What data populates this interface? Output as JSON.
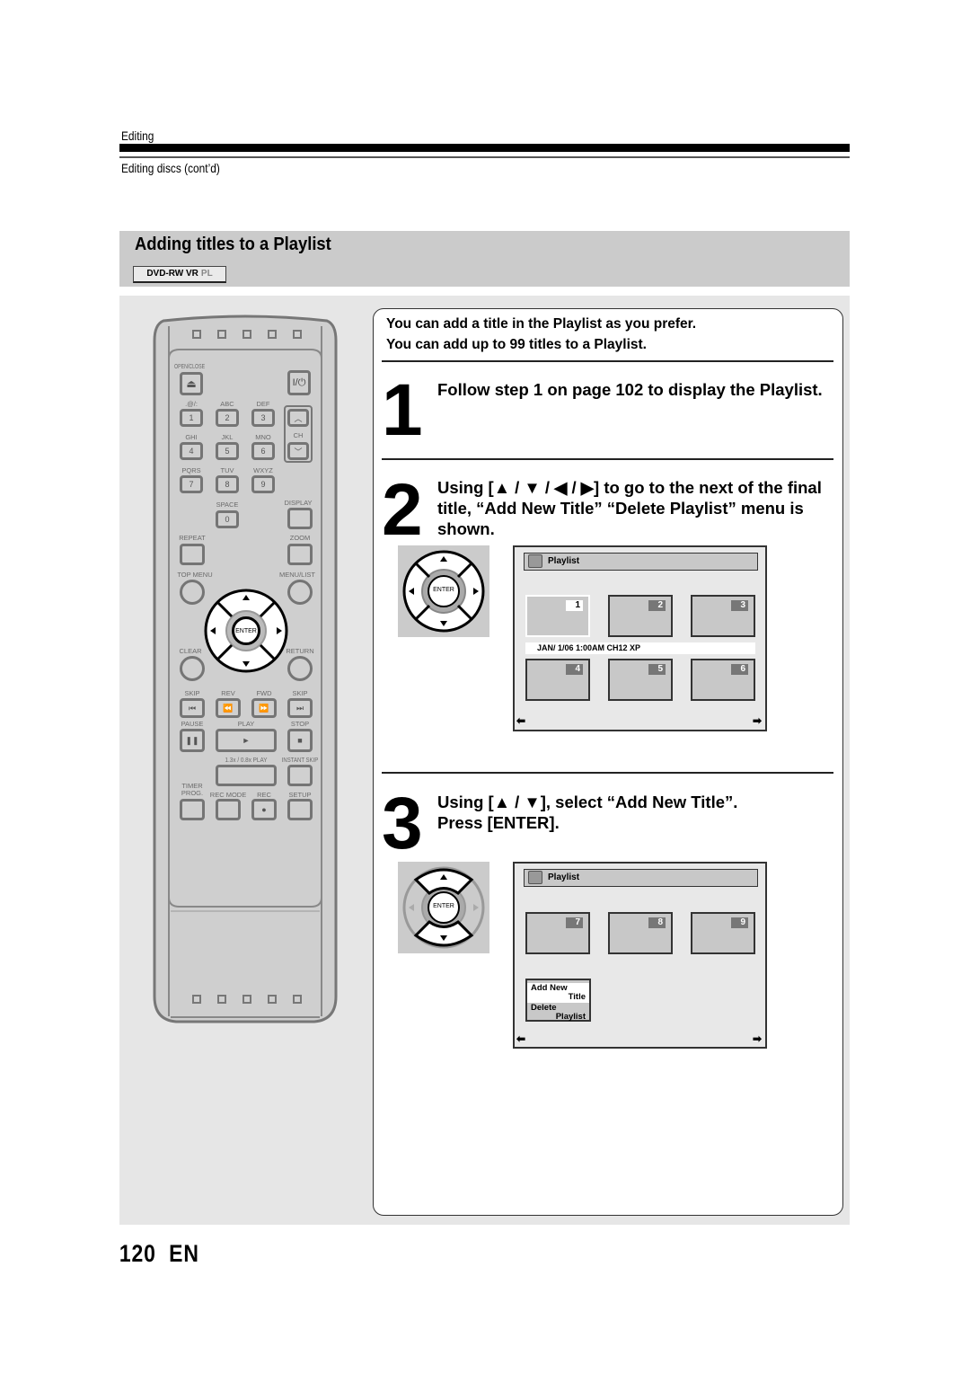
{
  "header": {
    "chapter": "Editing",
    "subsection": "Editing discs (cont’d)"
  },
  "section": {
    "title": "Adding titles to a Playlist",
    "disc_badge": "DVD-RW VR",
    "disc_badge_mark": "PL"
  },
  "intro": [
    "You can add a title in the Playlist as you prefer.",
    "You can add up to 99 titles to a Playlist."
  ],
  "steps": [
    {
      "number": "1",
      "text": "Follow step 1 on page 102 to display the Playlist."
    },
    {
      "number": "2",
      "text": "Using [▲ / ▼ / ◀ / ▶] to go to the next of the final title, “Add New Title” “Delete Playlist” menu is shown."
    },
    {
      "number": "3",
      "text": "Using [▲ / ▼], select “Add New Title”. Press [ENTER]."
    }
  ],
  "remote": {
    "open_close": "OPEN/CLOSE",
    "power": "I/⏻",
    "keys": [
      {
        "label": ".@/:",
        "num": "1"
      },
      {
        "label": "ABC",
        "num": "2"
      },
      {
        "label": "DEF",
        "num": "3"
      },
      {
        "label": "GHI",
        "num": "4"
      },
      {
        "label": "JKL",
        "num": "5"
      },
      {
        "label": "MNO",
        "num": "6"
      },
      {
        "label": "PQRS",
        "num": "7"
      },
      {
        "label": "TUV",
        "num": "8"
      },
      {
        "label": "WXYZ",
        "num": "9"
      }
    ],
    "space": "SPACE",
    "zero": "0",
    "ch": "CH",
    "display": "DISPLAY",
    "repeat": "REPEAT",
    "zoom": "ZOOM",
    "top_menu": "TOP MENU",
    "menu_list": "MENU/LIST",
    "enter": "ENTER",
    "clear": "CLEAR",
    "return": "RETURN",
    "skip_back": "SKIP",
    "rev": "REV",
    "fwd": "FWD",
    "skip_fwd": "SKIP",
    "pause": "PAUSE",
    "play": "PLAY",
    "stop": "STOP",
    "speed_play": "1.3x / 0.8x PLAY",
    "instant_skip": "INSTANT SKIP",
    "timer_prog": "TIMER PROG.",
    "rec_mode": "REC MODE",
    "rec": "REC",
    "setup": "SETUP"
  },
  "screen1": {
    "title": "Playlist",
    "thumbs": [
      "1",
      "2",
      "3",
      "4",
      "5",
      "6"
    ],
    "selected": "1",
    "info": "JAN/ 1/06 1:00AM CH12 XP"
  },
  "screen2": {
    "title": "Playlist",
    "thumbs": [
      "7",
      "8",
      "9"
    ],
    "menu": [
      {
        "line1": "Add New",
        "line2": "Title",
        "highlighted": true
      },
      {
        "line1": "Delete",
        "line2": "Playlist",
        "highlighted": false
      }
    ]
  },
  "dpad": {
    "enter": "ENTER"
  },
  "footer": {
    "page": "120",
    "lang": "EN"
  }
}
